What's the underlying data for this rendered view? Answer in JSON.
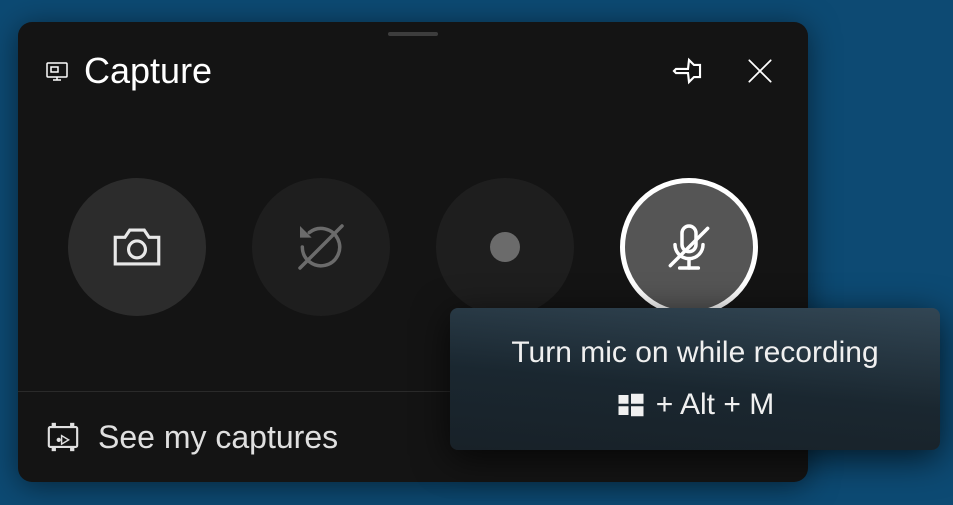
{
  "header": {
    "title": "Capture"
  },
  "actions": {
    "screenshot": "Screenshot",
    "record_last": "Record last 30 seconds",
    "record": "Start recording",
    "mic": "Microphone"
  },
  "footer": {
    "link": "See my captures"
  },
  "tooltip": {
    "title": "Turn mic on while recording",
    "shortcut_rest": "+ Alt + M"
  }
}
